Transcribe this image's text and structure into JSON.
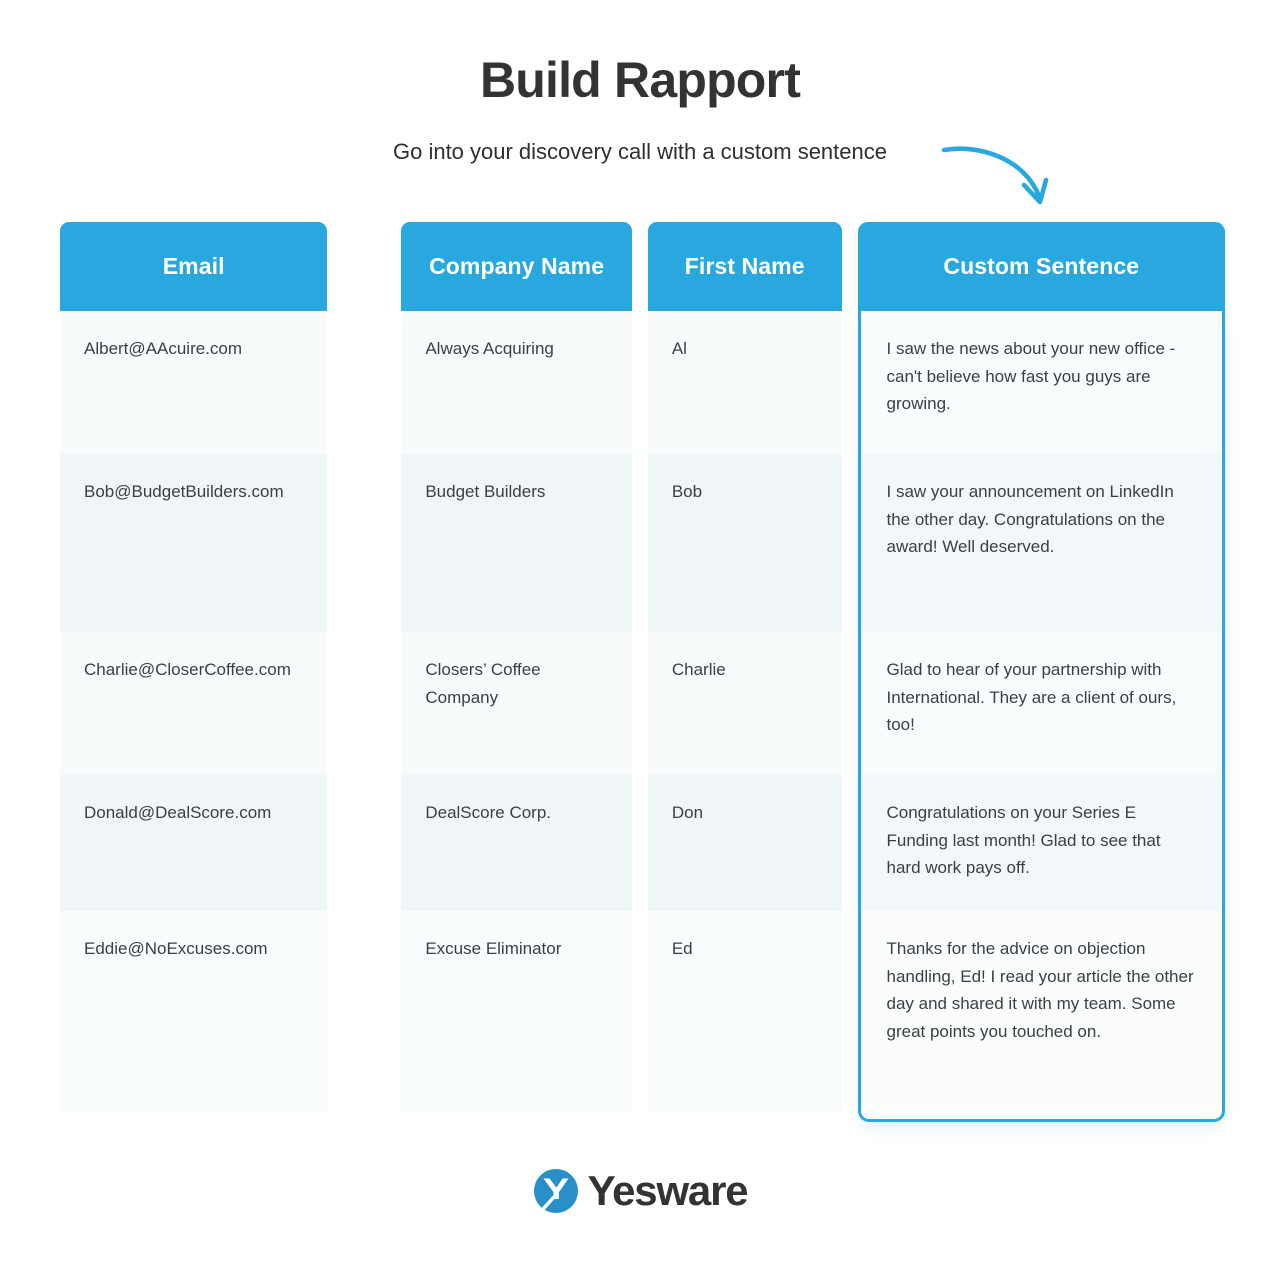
{
  "header": {
    "title": "Build Rapport",
    "subtitle": "Go into your discovery call with a custom sentence",
    "arrow_icon": "curved-arrow-down-right-icon",
    "accent_color": "#29a8df",
    "title_color": "#333333"
  },
  "table": {
    "columns": [
      {
        "key": "email",
        "label": "Email"
      },
      {
        "key": "company",
        "label": "Company Name"
      },
      {
        "key": "first",
        "label": "First Name"
      },
      {
        "key": "custom",
        "label": "Custom Sentence",
        "highlighted": true
      }
    ],
    "rows": [
      {
        "email": "Albert@AAcuire.com",
        "company": "Always Acquiring",
        "first": "Al",
        "custom": "I saw the news about your new office - can't believe how fast you guys are growing."
      },
      {
        "email": "Bob@BudgetBuilders.com",
        "company": "Budget Builders",
        "first": "Bob",
        "custom": "I saw your announcement on LinkedIn the other day. Congratulations on the award! Well deserved."
      },
      {
        "email": "Charlie@CloserCoffee.com",
        "company": "Closers’ Coffee Company",
        "first": "Charlie",
        "custom": "Glad to hear of your partnership with International. They are a client of ours, too!"
      },
      {
        "email": "Donald@DealScore.com",
        "company": "DealScore Corp.",
        "first": "Don",
        "custom": "Congratulations on your Series E Funding last month! Glad to see that hard work pays off."
      },
      {
        "email": "Eddie@NoExcuses.com",
        "company": "Excuse Eliminator",
        "first": "Ed",
        "custom": "Thanks for the advice on objection handling, Ed! I read your article the other day and shared it with my team. Some great points you touched on."
      }
    ]
  },
  "footer": {
    "brand": "Yesware",
    "logo_icon": "yesware-y-circle-logo",
    "logo_color": "#2a8fc7"
  }
}
